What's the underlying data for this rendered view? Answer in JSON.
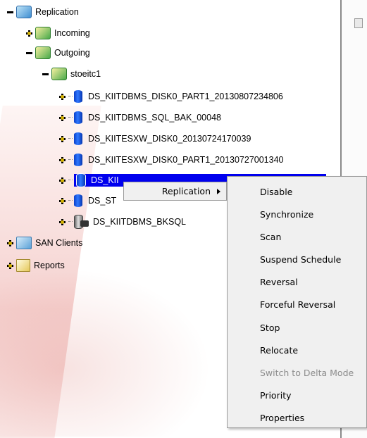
{
  "tree": {
    "replication": "Replication",
    "incoming": "Incoming",
    "outgoing": "Outgoing",
    "host": "stoeitc1",
    "resources": [
      "DS_KIITDBMS_DISK0_PART1_20130807234806",
      "DS_KIITDBMS_SQL_BAK_00048",
      "DS_KIITESXW_DISK0_20130724170039",
      "DS_KIITESXW_DISK0_PART1_20130727001340",
      "DS_KII",
      "DS_ST",
      "DS_KIITDBMS_BKSQL"
    ],
    "san_clients": "SAN Clients",
    "reports": "Reports"
  },
  "context_menu": {
    "replication_label": "Replication"
  },
  "submenu": {
    "items": [
      {
        "label": "Disable",
        "enabled": true
      },
      {
        "label": "Synchronize",
        "enabled": true
      },
      {
        "label": "Scan",
        "enabled": true
      },
      {
        "label": "Suspend Schedule",
        "enabled": true
      },
      {
        "label": "Reversal",
        "enabled": true
      },
      {
        "label": "Forceful Reversal",
        "enabled": true
      },
      {
        "label": "Stop",
        "enabled": true
      },
      {
        "label": "Relocate",
        "enabled": true
      },
      {
        "label": "Switch to Delta Mode",
        "enabled": false
      },
      {
        "label": "Priority",
        "enabled": true
      },
      {
        "label": "Properties",
        "enabled": true
      }
    ]
  },
  "colors": {
    "selection": "#0000ee",
    "menu_bg": "#f0f0f0",
    "disabled_text": "#8c8c8c"
  }
}
